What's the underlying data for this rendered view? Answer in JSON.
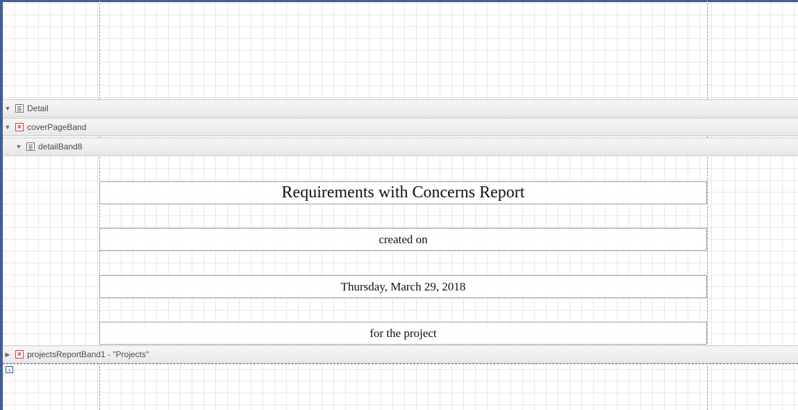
{
  "bands": {
    "detail": {
      "label": "Detail",
      "icon": "detail-band-icon"
    },
    "cover_page": {
      "label": "coverPageBand",
      "icon": "report-error-icon"
    },
    "detail_band8": {
      "label": "detailBand8",
      "icon": "detail-band-icon"
    },
    "projects_report": {
      "label": "projectsReportBand1 - \"Projects\"",
      "icon": "report-error-icon"
    }
  },
  "report": {
    "title": "Requirements with Concerns Report",
    "created_on": "created on",
    "date": "Thursday, March 29, 2018",
    "for_project": "for the project"
  },
  "colors": {
    "frame": "#3f5f92",
    "band_background": "#eeeeee",
    "error_icon": "#d23a3a"
  }
}
